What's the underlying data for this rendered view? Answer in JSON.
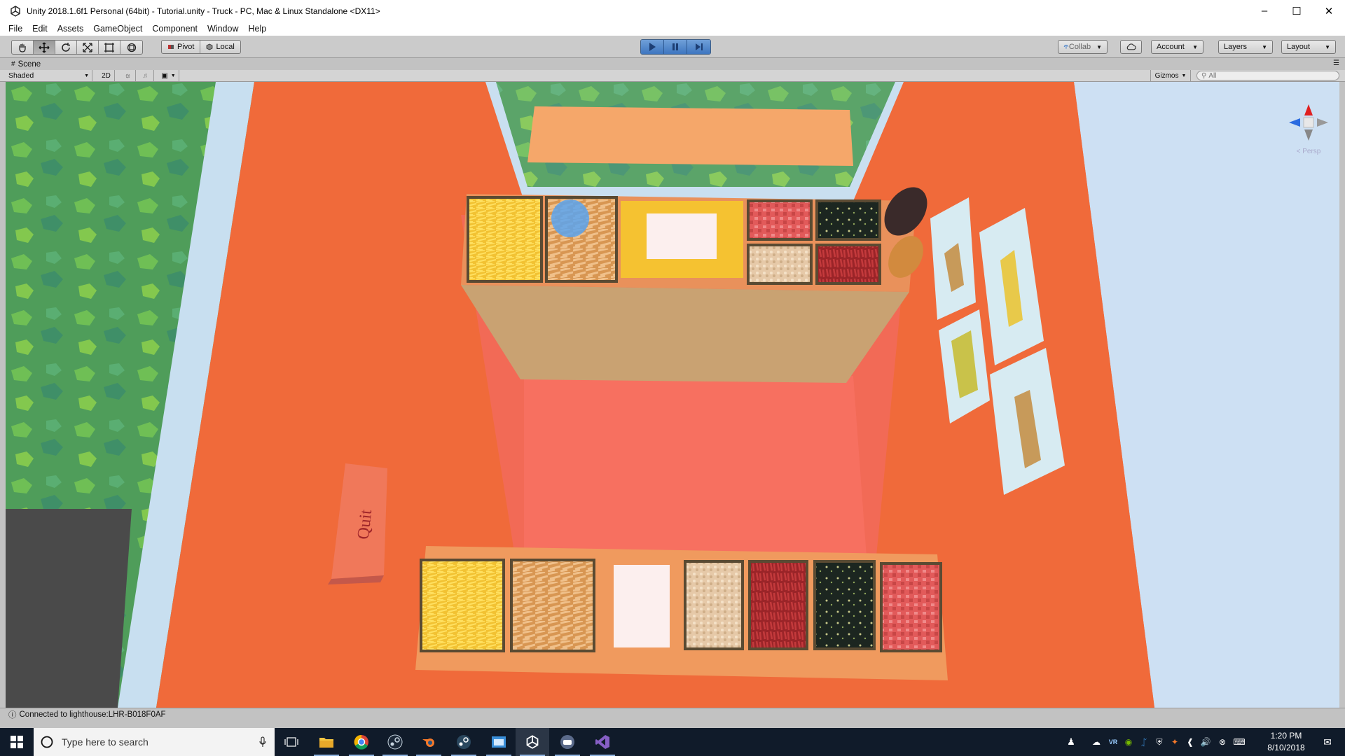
{
  "window": {
    "title": "Unity 2018.1.6f1 Personal (64bit) - Tutorial.unity - Truck - PC, Mac & Linux Standalone <DX11>"
  },
  "menu": [
    "File",
    "Edit",
    "Assets",
    "GameObject",
    "Component",
    "Window",
    "Help"
  ],
  "toolbar": {
    "pivot_label": "Pivot",
    "local_label": "Local",
    "collab_label": "Collab",
    "account_label": "Account",
    "layers_label": "Layers",
    "layout_label": "Layout"
  },
  "scene": {
    "tab_label": "Scene",
    "shading_mode": "Shaded",
    "mode_2d_label": "2D",
    "gizmos_label": "Gizmos",
    "search_placeholder": "All",
    "quit_sign": "Quit",
    "persp_label": "< Persp"
  },
  "status": {
    "message": "Connected to lighthouse:LHR-B018F0AF"
  },
  "taskbar": {
    "search_placeholder": "Type here to search",
    "time": "1:20 PM",
    "date": "8/10/2018"
  },
  "colors": {
    "play_blue": "#4a83cb",
    "truck_orange": "#f06a3a",
    "taskbar": "#101b2a"
  }
}
